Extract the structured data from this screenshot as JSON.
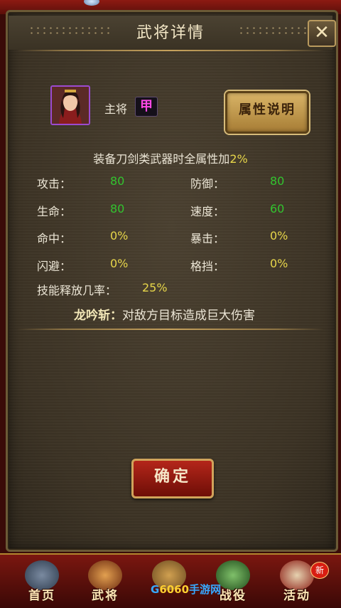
{
  "dialog": {
    "title": "武将详情",
    "close_label": "✕"
  },
  "general": {
    "role_label": "主将",
    "rank": "甲",
    "info_button_label": "属性说明"
  },
  "bonus": {
    "text": "装备刀剑类武器时全属性加",
    "value": "2%"
  },
  "stats": {
    "attack": {
      "label": "攻击：",
      "value": "80"
    },
    "defense": {
      "label": "防御：",
      "value": "80"
    },
    "hp": {
      "label": "生命：",
      "value": "80"
    },
    "speed": {
      "label": "速度：",
      "value": "60"
    },
    "hit": {
      "label": "命中：",
      "value": "0%"
    },
    "crit": {
      "label": "暴击：",
      "value": "0%"
    },
    "dodge": {
      "label": "闪避：",
      "value": "0%"
    },
    "block": {
      "label": "格挡：",
      "value": "0%"
    },
    "skill_rate": {
      "label": "技能释放几率：",
      "value": "25%"
    }
  },
  "skill": {
    "name": "龙吟斩：",
    "description": "对敌方目标造成巨大伤害"
  },
  "confirm_label": "确定",
  "nav": {
    "items": [
      {
        "label": "首页",
        "icon": "home-icon"
      },
      {
        "label": "武将",
        "icon": "general-icon"
      },
      {
        "label": "",
        "icon": "equipment-icon"
      },
      {
        "label": "战役",
        "icon": "campaign-icon"
      },
      {
        "label": "活动",
        "icon": "event-icon"
      }
    ],
    "new_badge": "新"
  },
  "watermark": {
    "part1": "G",
    "part2": "6060",
    "part3": "手游网"
  },
  "colors": {
    "stat_green": "#32c42f",
    "stat_yellow": "#e7d64a",
    "rank_purple": "#ff49e6"
  }
}
